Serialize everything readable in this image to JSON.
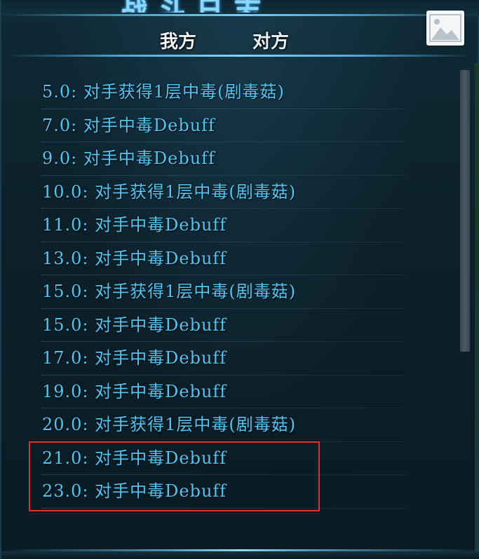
{
  "title": "战斗日志",
  "tabs": [
    {
      "label": "我方"
    },
    {
      "label": "对方"
    }
  ],
  "icons": {
    "image": "image-icon"
  },
  "log": [
    {
      "text": "5.0: 对手获得1层中毒(剧毒菇)"
    },
    {
      "text": "7.0: 对手中毒Debuff"
    },
    {
      "text": "9.0: 对手中毒Debuff"
    },
    {
      "text": "10.0: 对手获得1层中毒(剧毒菇)"
    },
    {
      "text": "11.0: 对手中毒Debuff"
    },
    {
      "text": "13.0: 对手中毒Debuff"
    },
    {
      "text": "15.0: 对手获得1层中毒(剧毒菇)"
    },
    {
      "text": "15.0: 对手中毒Debuff"
    },
    {
      "text": "17.0: 对手中毒Debuff"
    },
    {
      "text": "19.0: 对手中毒Debuff"
    },
    {
      "text": "20.0: 对手获得1层中毒(剧毒菇)"
    },
    {
      "text": "21.0: 对手中毒Debuff"
    },
    {
      "text": "23.0: 对手中毒Debuff"
    }
  ],
  "colors": {
    "log_text": "#52c6f2",
    "tab_text": "#f2f6f8",
    "highlight_border": "#e0302c",
    "glow": "#8cdcff"
  }
}
